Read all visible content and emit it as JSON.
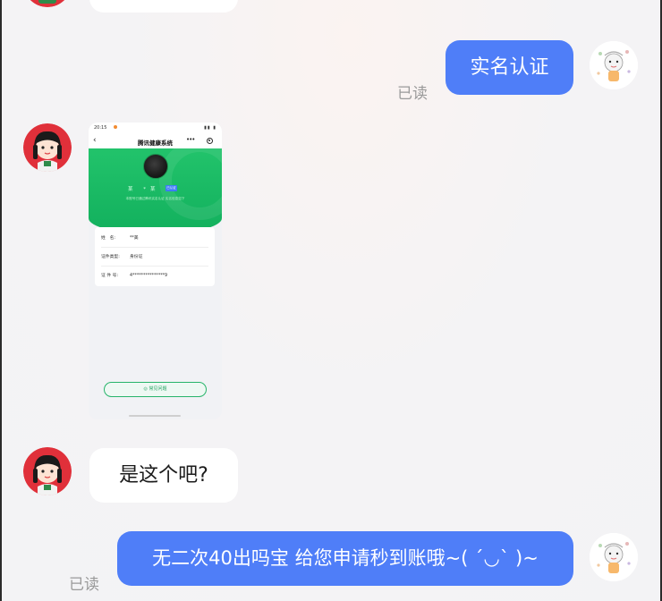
{
  "messages": {
    "m1": {
      "text": "实名认证",
      "status": "已读"
    },
    "m2": {
      "type": "image"
    },
    "m3": {
      "text": "是这个吧?"
    },
    "m4": {
      "text": "无二次40出吗宝 给您申请秒到账哦~( ´◡` )~",
      "status": "已读"
    }
  },
  "shared_screenshot": {
    "status_time": "20:15",
    "status_icons": "▮▮ ▮",
    "back_icon": "chevron-left-icon",
    "title": "腾讯健康系统",
    "more_icon": "•••",
    "record_icon": "target-icon",
    "name_masked": "某 *某",
    "name_tag": "已认证",
    "subtitle": "本账号已通过腾讯实名认证  实名信息如下",
    "rows": [
      {
        "key": "姓　名:",
        "value": "**美"
      },
      {
        "key": "证件类型:",
        "value": "身份证"
      },
      {
        "key": "证 件 号:",
        "value": "4***************9"
      }
    ],
    "help_button": "◎ 常见问题"
  },
  "colors": {
    "outgoing_bubble": "#4f7ef8",
    "incoming_bubble": "#ffffff",
    "read_status": "#9a9a9a",
    "screenshot_header_green": "#18b663"
  }
}
